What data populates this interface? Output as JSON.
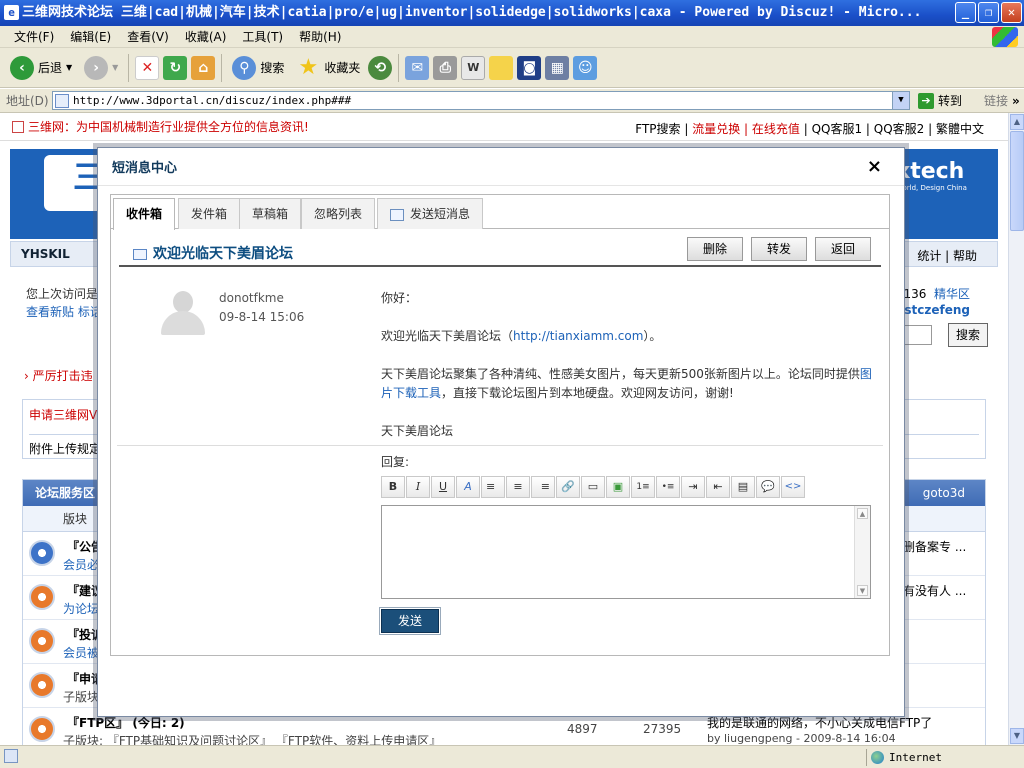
{
  "window": {
    "title": "三维网技术论坛 三维|cad|机械|汽车|技术|catia|pro/e|ug|inventor|solidedge|solidworks|caxa - Powered by Discuz! - Micro...",
    "buttons": {
      "minimize": "_",
      "restore": "❐",
      "close": "✕"
    }
  },
  "menu": [
    "文件(F)",
    "编辑(E)",
    "查看(V)",
    "收藏(A)",
    "工具(T)",
    "帮助(H)"
  ],
  "toolbar": {
    "back": "后退",
    "search": "搜索",
    "favorites": "收藏夹"
  },
  "address": {
    "label": "地址(D)",
    "url": "http://www.3dportal.cn/discuz/index.php###",
    "go": "转到",
    "links": "链接"
  },
  "page": {
    "slogan": "三维网：为中国机械制造行业提供全方位的信息资讯!",
    "toplinks": {
      "ftp": "FTP搜索 |",
      "flow": "流量兑换",
      "recharge": "| 在线充值",
      "qq": "| QQ客服1 | QQ客服2 | 繁體中文"
    },
    "banner_logo": "三",
    "banner_right": "xtech",
    "banner_right_sub": "World, Design China",
    "nav_user": "YHSKIL",
    "nav_right": "统计 | 帮助",
    "info_left1": "您上次访问是",
    "info_left2": "查看新贴  标话",
    "info_right1": "136",
    "info_right1_link": "精华区",
    "info_right2": "uestczefeng",
    "search_btn": "搜索",
    "notice": "严厉打击违",
    "notbox_a": "申请三维网V",
    "notbox_b": "附件上传规定",
    "forum_header": "论坛服务区",
    "forum_header_right": "goto3d",
    "forum_col": "版块",
    "forum_rows": [
      {
        "title": "『公告",
        "sub": "会员必",
        "lp": "删备案专 ..."
      },
      {
        "title": "『建议",
        "sub": "为论坛",
        "lp": "有没有人 ..."
      },
      {
        "title": "『投诉",
        "sub": "会员被",
        "lp": ""
      },
      {
        "title": "『申请",
        "sub": "子版块",
        "lp": ""
      },
      {
        "title": "『FTP区』 (今日: 2)",
        "sub": "子版块: 『FTP基础知识及问题讨论区』 『FTP软件、资料上传申请区』",
        "c1": "4897",
        "c2": "27395",
        "lp": "我的是联通的网络，不小心关成电信FTP了",
        "lp2": "by liugengpeng - 2009-8-14 16:04"
      }
    ]
  },
  "modal": {
    "title": "短消息中心",
    "close": "×",
    "tabs": [
      "收件箱",
      "发件箱",
      "草稿箱",
      "忽略列表",
      "发送短消息"
    ],
    "message_title": "欢迎光临天下美眉论坛",
    "actions": [
      "删除",
      "转发",
      "返回"
    ],
    "sender": "donotfkme",
    "time": "09-8-14 15:06",
    "greeting": "你好：",
    "line1_pre": "欢迎光临天下美眉论坛（",
    "line1_link": "http://tianxiamm.com",
    "line1_post": "）。",
    "line2_pre": "天下美眉论坛聚集了各种清纯、性感美女图片，每天更新500张新图片以上。论坛同时提供",
    "line2_link": "图片下载工具",
    "line2_post": "，直接下载论坛图片到本地硬盘。欢迎网友访问，谢谢!",
    "signature": "天下美眉论坛",
    "reply_label": "回复:",
    "editor_buttons": [
      "B",
      "I",
      "U",
      "A",
      "≡",
      "≡",
      "≡",
      "🔗",
      "▭",
      "▣",
      "1≡",
      "•≡",
      "⇥",
      "⇤",
      "▤",
      "💬",
      "<>"
    ],
    "send": "发送"
  },
  "status": {
    "zone": "Internet"
  },
  "colors": {
    "accent": "#1d62b8",
    "modal_title": "#123a5c",
    "send_button": "#1b4f7a",
    "slogan": "#cc0000"
  }
}
